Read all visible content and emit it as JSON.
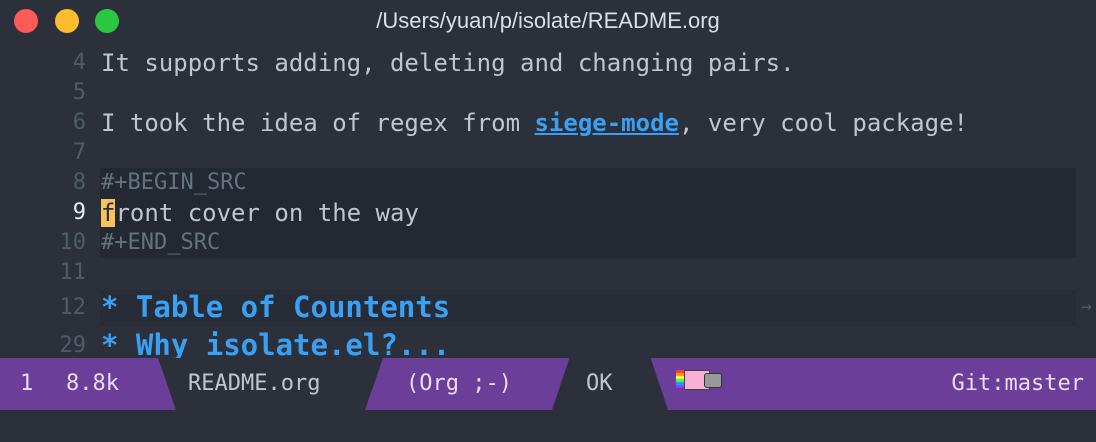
{
  "window": {
    "title": "/Users/yuan/p/isolate/README.org"
  },
  "editor": {
    "lines": [
      {
        "num": "4",
        "text": "It supports adding, deleting and changing pairs."
      },
      {
        "num": "5",
        "text": ""
      },
      {
        "num": "6",
        "before": "I took the idea of regex from ",
        "link": "siege-mode",
        "after": ", very cool package!"
      },
      {
        "num": "7",
        "text": ""
      },
      {
        "num": "8",
        "text": "#+BEGIN_SRC"
      },
      {
        "num": "9",
        "cursor": "f",
        "text": "ront cover on the way"
      },
      {
        "num": "10",
        "text": "#+END_SRC"
      },
      {
        "num": "11",
        "text": ""
      },
      {
        "num": "12",
        "text": "* Table of Countents"
      },
      {
        "num": "29",
        "text": "* Why isolate.el?..."
      }
    ]
  },
  "modeline": {
    "position": "1",
    "size": "8.8k",
    "filename": "README.org",
    "mode": "(Org ;-)",
    "status": "OK",
    "vcs": "Git:master"
  },
  "icons": {
    "fringe": "continuation-arrow-icon",
    "nyan": "nyan-cat-icon"
  },
  "colors": {
    "background": "#2b303b",
    "modeline": "#6b3e99",
    "link": "#39a0f3",
    "cursor": "#f6c35c"
  }
}
